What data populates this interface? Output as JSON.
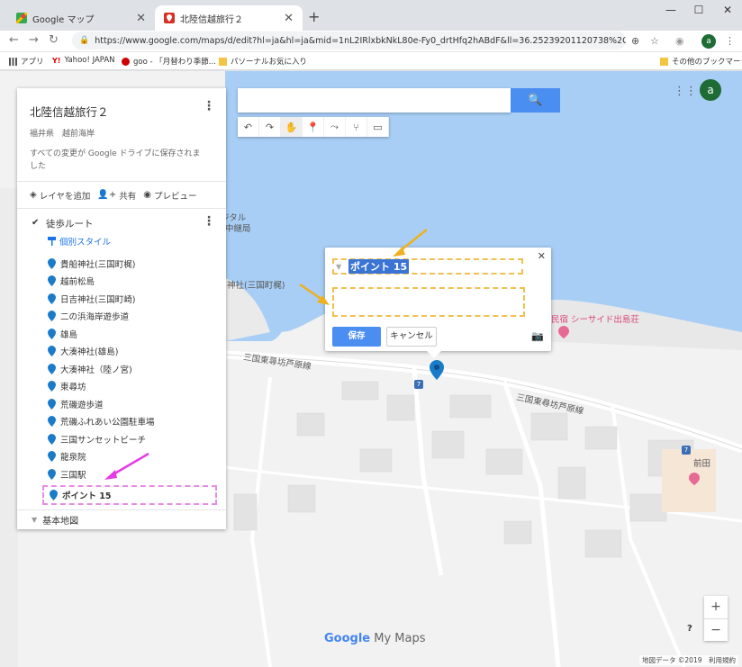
{
  "tabs": [
    {
      "title": "Google マップ",
      "active": false
    },
    {
      "title": "北陸信越旅行２",
      "active": true
    }
  ],
  "window_controls": {
    "minimize": "—",
    "maximize": "☐",
    "close": "✕"
  },
  "address": {
    "url": "https://www.google.com/maps/d/edit?hl=ja&hl=ja&mid=1nL2IRlxbkNkL80e-Fy0_drtHfq2hABdF&ll=36.25239201120738%2C136.1499208...",
    "avatar_letter": "a"
  },
  "bookmarks": [
    {
      "label": "アプリ"
    },
    {
      "label": "Yahoo! JAPAN"
    },
    {
      "label": "goo - 「月替わり季節..."
    },
    {
      "label": "パソーナルお気に入り"
    },
    {
      "label": "その他のブックマーク"
    }
  ],
  "panel": {
    "title": "北陸信越旅行２",
    "subtitle": "福井県　越前海岸",
    "saved": "すべての変更が Google ドライブに保存されました",
    "actions": {
      "add_layer": "レイヤを追加",
      "share": "共有",
      "preview": "プレビュー"
    },
    "layer": {
      "name": "徒歩ルート",
      "style_link": "個別スタイル",
      "items": [
        "貴船神社(三国町梶)",
        "越前松島",
        "日吉神社(三国町崎)",
        "二の浜海岸遊歩道",
        "雄島",
        "大湊神社(雄島)",
        "大湊神社（陸ノ宮)",
        "東尋坊",
        "荒磯遊歩道",
        "荒磯ふれあい公園駐車場",
        "三国サンセットビーチ",
        "龍泉院",
        "三国駅"
      ],
      "selected_item": "ポイント 15"
    },
    "basemap": "基本地図"
  },
  "popup": {
    "title": "ポイント 15",
    "save": "保存",
    "cancel": "キャンセル"
  },
  "map_labels": {
    "road1": "三国東尋坊芦原線",
    "road2": "三国東尋坊芦原線",
    "inn": "民宿 シーサイド出島荘",
    "maeda": "前田",
    "digital": "ジタル",
    "relay": "中継局",
    "shrine": "神社(三国町梶)",
    "route_no": "7"
  },
  "logo": {
    "google": "Google",
    "mymaps": "My Maps"
  },
  "footer": "地図データ ©2019　利用規約",
  "colors": {
    "accent": "#4b8ef1",
    "pin": "#1a7bc9",
    "water": "#a8cef5",
    "highlight_dash": "#e58ce5",
    "popup_dash": "#f0c050"
  }
}
